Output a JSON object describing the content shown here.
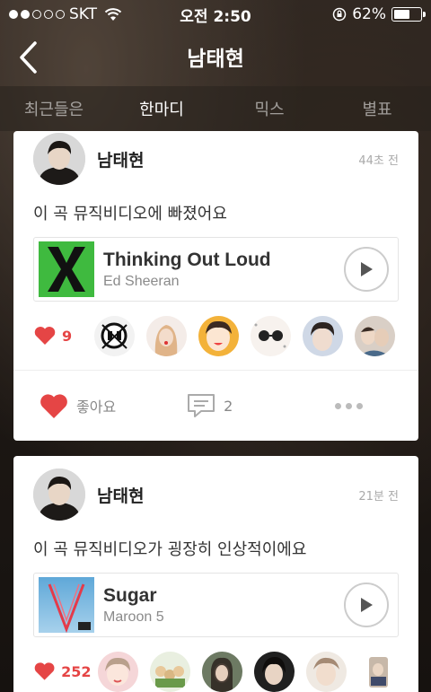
{
  "status_bar": {
    "carrier": "SKT",
    "time": "오전 2:50",
    "battery": "62%",
    "battery_level": 0.62,
    "signal_bars_filled": 2,
    "signal_bars_total": 5
  },
  "nav": {
    "title": "남태현"
  },
  "tabs": [
    {
      "label": "최근들은",
      "active": false
    },
    {
      "label": "한마디",
      "active": true
    },
    {
      "label": "믹스",
      "active": false
    },
    {
      "label": "별표",
      "active": false
    }
  ],
  "posts": [
    {
      "author": "남태현",
      "time": "44초 전",
      "text": "이 곡 뮤직비디오에 빠졌어요",
      "track": {
        "title": "Thinking Out Loud",
        "artist": "Ed Sheeran"
      },
      "likes": "9",
      "like_label": "좋아요",
      "comments": "2"
    },
    {
      "author": "남태현",
      "time": "21분 전",
      "text": "이 곡 뮤직비디오가 굉장히 인상적이에요",
      "track": {
        "title": "Sugar",
        "artist": "Maroon 5"
      },
      "likes": "252"
    }
  ],
  "colors": {
    "accent": "#e54545",
    "card": "#ffffff",
    "album_x_green": "#3fba3f"
  },
  "icons": [
    "back-arrow-icon",
    "wifi-icon",
    "lock-icon",
    "battery-icon",
    "play-icon",
    "heart-icon",
    "comment-icon",
    "more-icon"
  ]
}
